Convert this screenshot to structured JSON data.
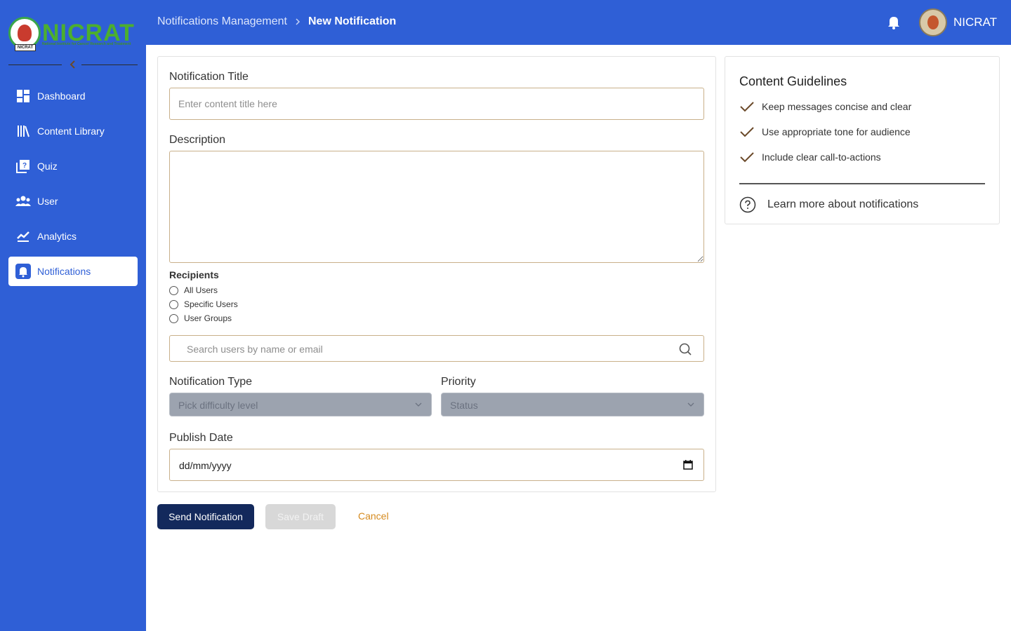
{
  "brand": {
    "name": "NICRAT",
    "subtitle": "National Institute for Cancer Research and Treatment",
    "seal_tag": "NICRAT",
    "primary_color": "#2f5fd6",
    "logo_green": "#4caf2e"
  },
  "sidebar": {
    "items": [
      {
        "label": "Dashboard",
        "icon": "dashboard-icon",
        "active": false
      },
      {
        "label": "Content Library",
        "icon": "library-icon",
        "active": false
      },
      {
        "label": "Quiz",
        "icon": "quiz-icon",
        "active": false
      },
      {
        "label": "User",
        "icon": "users-icon",
        "active": false
      },
      {
        "label": "Analytics",
        "icon": "analytics-icon",
        "active": false
      },
      {
        "label": "Notifications",
        "icon": "bell-icon",
        "active": true
      }
    ]
  },
  "header": {
    "breadcrumb_parent": "Notifications Management",
    "breadcrumb_current": "New Notification",
    "user_name": "NICRAT"
  },
  "form": {
    "title_label": "Notification Title",
    "title_placeholder": "Enter content title here",
    "title_value": "",
    "description_label": "Description",
    "description_value": "",
    "recipients_label": "Recipients",
    "recipient_options": [
      "All Users",
      "Specific Users",
      "User Groups"
    ],
    "search_placeholder": "Search users by name or email",
    "type_label": "Notification Type",
    "type_value": "Pick difficulty level",
    "priority_label": "Priority",
    "priority_value": "Status",
    "publish_label": "Publish Date",
    "publish_value": "dd/mm/yyyy"
  },
  "actions": {
    "send": "Send Notification",
    "draft": "Save Draft",
    "cancel": "Cancel",
    "send_color": "#13295c",
    "cancel_color": "#d58a1e"
  },
  "guidelines": {
    "title": "Content Guidelines",
    "items": [
      "Keep messages concise and clear",
      "Use appropriate tone for audience",
      "Include clear call-to-actions"
    ],
    "learn_more": "Learn more about notifications"
  }
}
